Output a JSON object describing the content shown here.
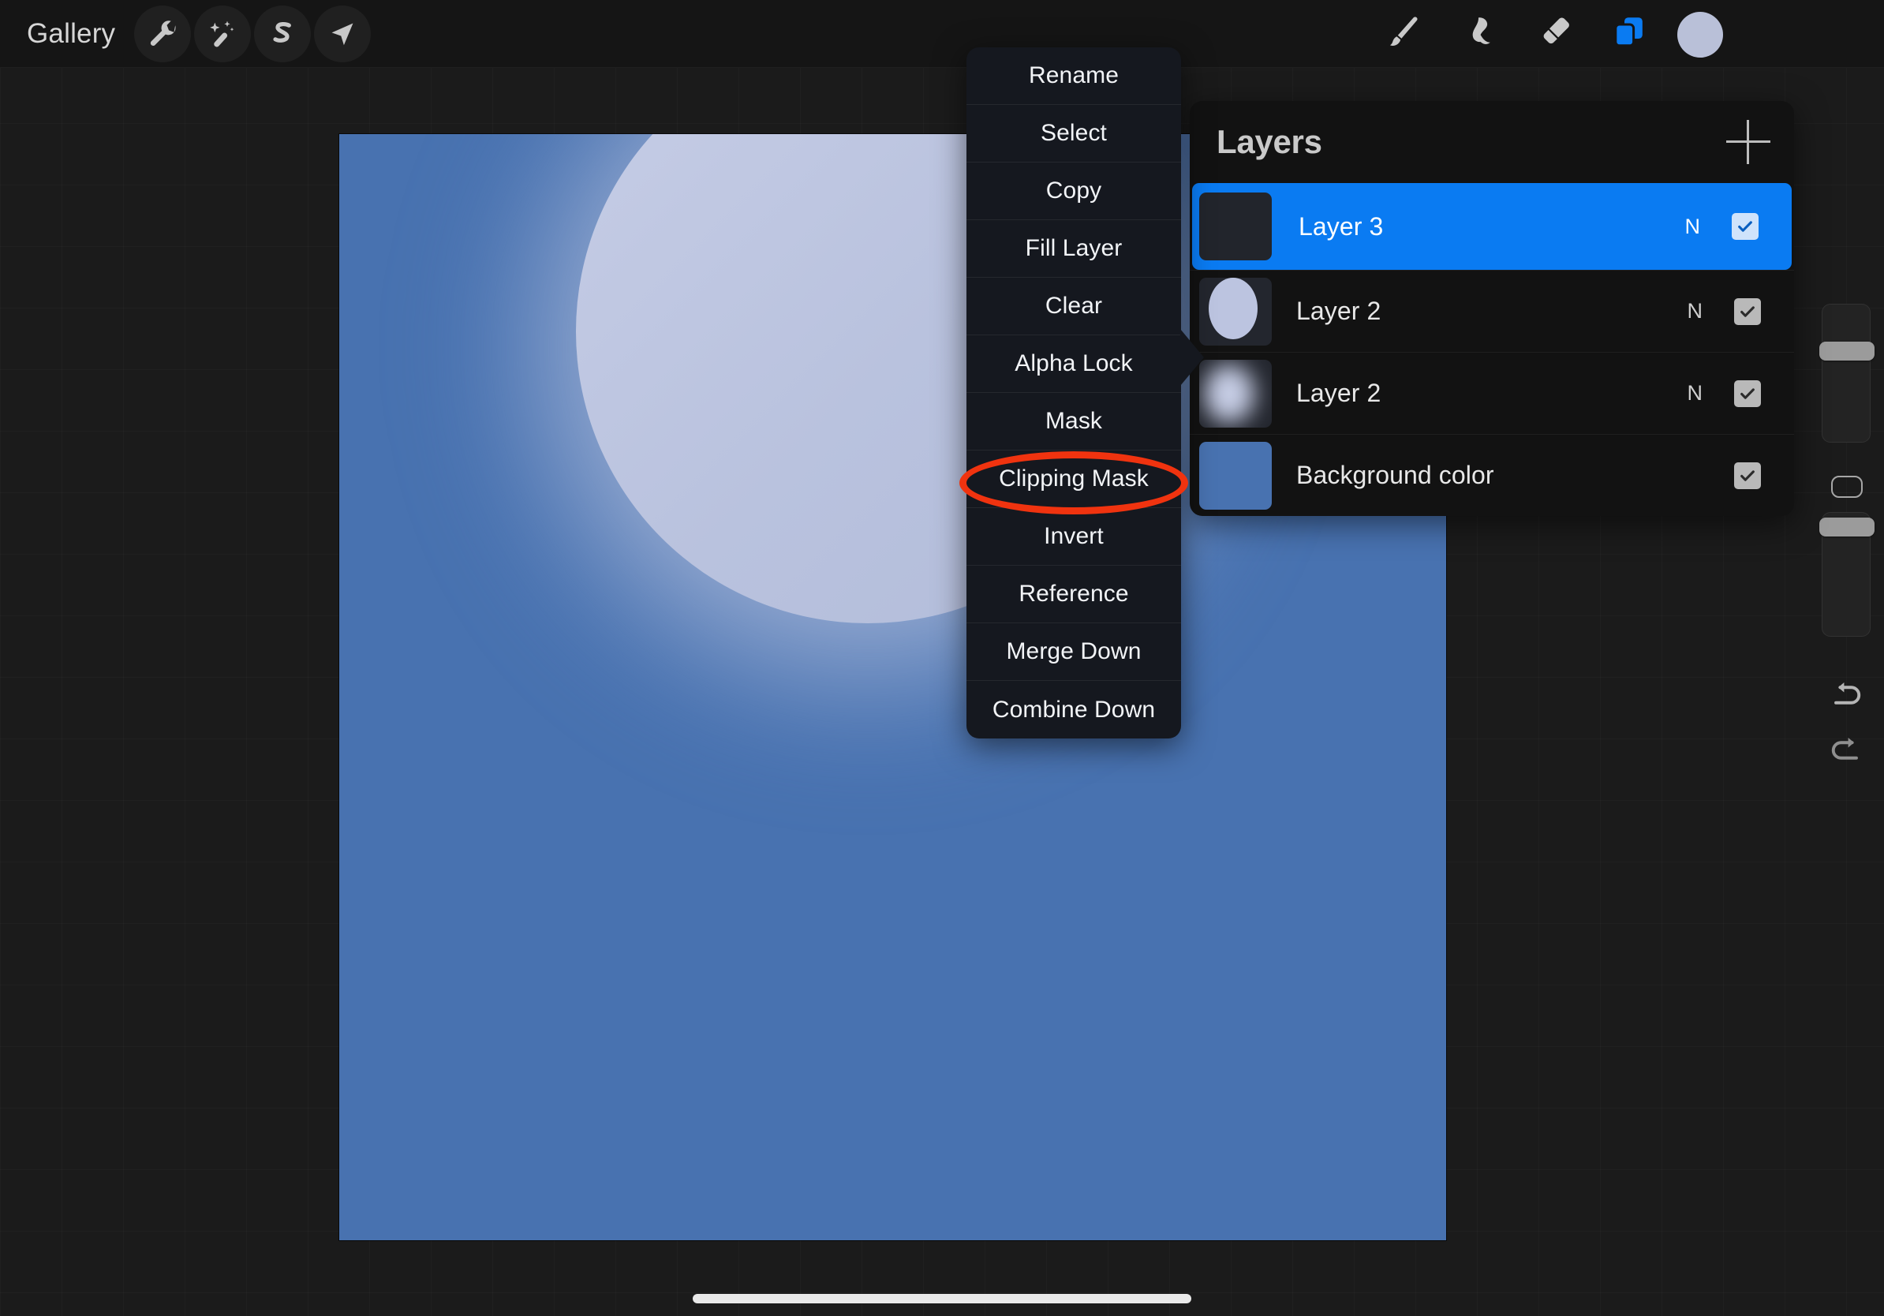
{
  "app": {
    "name": "Procreate",
    "background_color": "#1b1b1b"
  },
  "topbar": {
    "gallery_label": "Gallery",
    "left_tools": [
      {
        "name": "actions-wrench",
        "label": "Actions",
        "icon": "wrench-icon"
      },
      {
        "name": "adjustments-wand",
        "label": "Adjustments",
        "icon": "magic-wand-icon"
      },
      {
        "name": "selection-s",
        "label": "Selection",
        "icon": "selection-icon"
      },
      {
        "name": "transform-arrow",
        "label": "Transform",
        "icon": "arrow-transform-icon"
      }
    ],
    "right_tools": [
      {
        "name": "paint-brush",
        "label": "Paint",
        "icon": "brush-icon",
        "active": false
      },
      {
        "name": "smudge",
        "label": "Smudge",
        "icon": "smudge-icon",
        "active": false
      },
      {
        "name": "eraser",
        "label": "Erase",
        "icon": "eraser-icon",
        "active": false
      },
      {
        "name": "layers",
        "label": "Layers",
        "icon": "layers-icon",
        "active": true
      }
    ],
    "color_swatch": "#b9c0d8",
    "active_tool_color": "#0a7BF2"
  },
  "canvas": {
    "background_color": "#4872b0",
    "orb_color": "#c0c8e2",
    "glow_color": "#b9c2de"
  },
  "context_menu": {
    "items": [
      {
        "label": "Rename"
      },
      {
        "label": "Select"
      },
      {
        "label": "Copy"
      },
      {
        "label": "Fill Layer"
      },
      {
        "label": "Clear"
      },
      {
        "label": "Alpha Lock"
      },
      {
        "label": "Mask"
      },
      {
        "label": "Clipping Mask"
      },
      {
        "label": "Invert"
      },
      {
        "label": "Reference"
      },
      {
        "label": "Merge Down"
      },
      {
        "label": "Combine Down"
      }
    ],
    "highlighted_item": "Clipping Mask",
    "annotation_color": "#F0330F",
    "background_color": "#15181f"
  },
  "layers_panel": {
    "title": "Layers",
    "add_button_label": "+",
    "selected_color": "#0a7BF2",
    "layers": [
      {
        "name": "Layer 3",
        "blend_mode": "N",
        "visible": true,
        "selected": true,
        "thumbnail": "empty"
      },
      {
        "name": "Layer 2",
        "blend_mode": "N",
        "visible": true,
        "selected": false,
        "thumbnail": "ellipse"
      },
      {
        "name": "Layer 2",
        "blend_mode": "N",
        "visible": true,
        "selected": false,
        "thumbnail": "blurred-ellipse"
      },
      {
        "name": "Background color",
        "blend_mode": "",
        "visible": true,
        "selected": false,
        "thumbnail": "solid-blue"
      }
    ]
  },
  "sidebar": {
    "brush_size_slider": {
      "name": "brush-size-slider",
      "value_pct": 73
    },
    "modify_button": {
      "name": "modify-button"
    },
    "opacity_slider": {
      "name": "opacity-slider",
      "value_pct": 96
    },
    "undo_button": {
      "name": "undo-button",
      "icon": "undo-arrow-icon"
    },
    "redo_button": {
      "name": "redo-button",
      "icon": "redo-arrow-icon"
    }
  }
}
